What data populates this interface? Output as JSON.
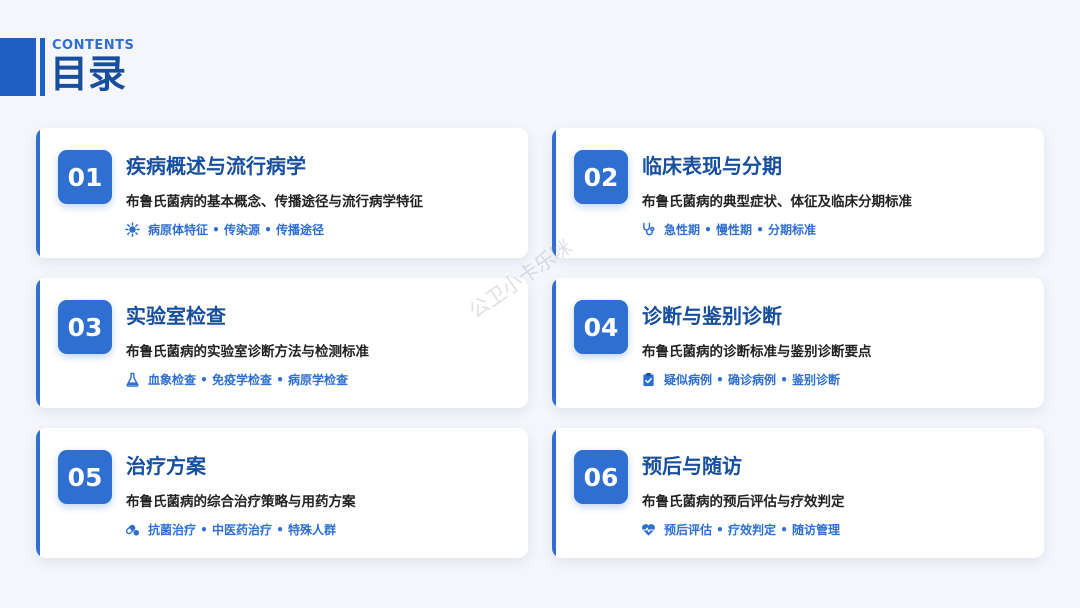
{
  "header": {
    "en_title": "CONTENTS",
    "cn_title": "目录"
  },
  "watermark": "公卫小卡乐咪",
  "colors": {
    "accent": "#2f6fd2",
    "title": "#184e9e",
    "background": "#f4f6fb"
  },
  "cards": [
    {
      "num": "01",
      "title": "疾病概述与流行病学",
      "desc": "布鲁氏菌病的基本概念、传播途径与流行病学特征",
      "icon": "virus-icon",
      "tags": "病原体特征 • 传染源 • 传播途径"
    },
    {
      "num": "02",
      "title": "临床表现与分期",
      "desc": "布鲁氏菌病的典型症状、体征及临床分期标准",
      "icon": "stethoscope-icon",
      "tags": "急性期 • 慢性期 • 分期标准"
    },
    {
      "num": "03",
      "title": "实验室检查",
      "desc": "布鲁氏菌病的实验室诊断方法与检测标准",
      "icon": "flask-icon",
      "tags": "血象检查 • 免疫学检查 • 病原学检查"
    },
    {
      "num": "04",
      "title": "诊断与鉴别诊断",
      "desc": "布鲁氏菌病的诊断标准与鉴别诊断要点",
      "icon": "clipboard-check-icon",
      "tags": "疑似病例 • 确诊病例 • 鉴别诊断"
    },
    {
      "num": "05",
      "title": "治疗方案",
      "desc": "布鲁氏菌病的综合治疗策略与用药方案",
      "icon": "pills-icon",
      "tags": "抗菌治疗 • 中医药治疗 • 特殊人群"
    },
    {
      "num": "06",
      "title": "预后与随访",
      "desc": "布鲁氏菌病的预后评估与疗效判定",
      "icon": "heart-pulse-icon",
      "tags": "预后评估 • 疗效判定 • 随访管理"
    }
  ]
}
